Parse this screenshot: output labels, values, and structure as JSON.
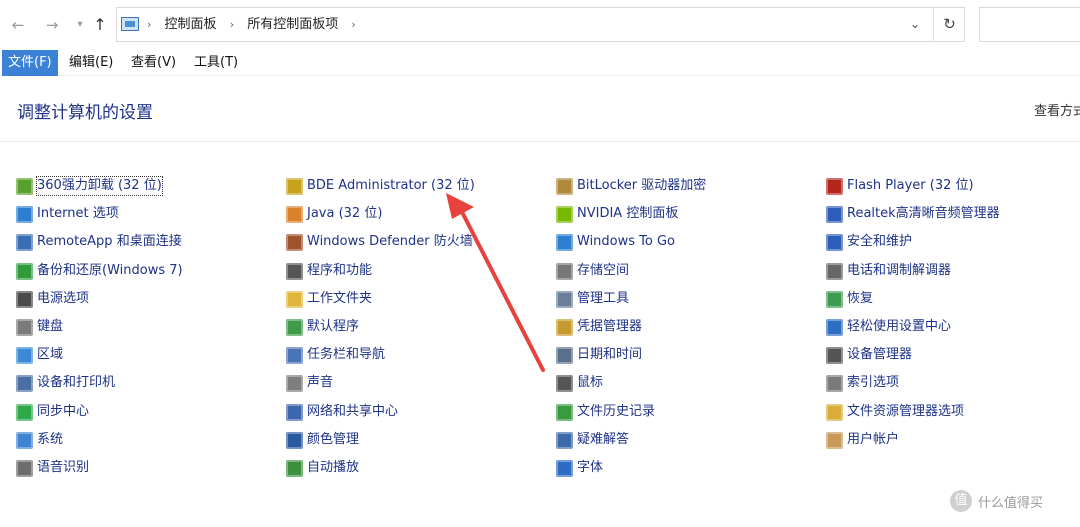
{
  "address": {
    "crumbs": [
      "控制面板",
      "所有控制面板项"
    ]
  },
  "menu": [
    "文件(F)",
    "编辑(E)",
    "查看(V)",
    "工具(T)"
  ],
  "header": {
    "title": "调整计算机的设置",
    "view_by": "查看方式"
  },
  "columns": [
    [
      {
        "label": "360强力卸载 (32 位)",
        "icon": "uninstall-icon",
        "color": "#5aa02c"
      },
      {
        "label": "Internet 选项",
        "icon": "internet-options-icon",
        "color": "#2f7fd1"
      },
      {
        "label": "RemoteApp 和桌面连接",
        "icon": "remoteapp-icon",
        "color": "#3a6fb5"
      },
      {
        "label": "备份和还原(Windows 7)",
        "icon": "backup-icon",
        "color": "#2f9b3c"
      },
      {
        "label": "电源选项",
        "icon": "power-icon",
        "color": "#4a4a4a"
      },
      {
        "label": "键盘",
        "icon": "keyboard-icon",
        "color": "#7a7a7a"
      },
      {
        "label": "区域",
        "icon": "region-globe-icon",
        "color": "#3b8ad6"
      },
      {
        "label": "设备和打印机",
        "icon": "printer-icon",
        "color": "#4b6fa3"
      },
      {
        "label": "同步中心",
        "icon": "sync-icon",
        "color": "#2fa84a"
      },
      {
        "label": "系统",
        "icon": "system-monitor-icon",
        "color": "#3f83d1"
      },
      {
        "label": "语音识别",
        "icon": "microphone-icon",
        "color": "#6d6d6d"
      }
    ],
    [
      {
        "label": "BDE Administrator (32 位)",
        "icon": "bde-admin-icon",
        "color": "#c7a21c"
      },
      {
        "label": "Java (32 位)",
        "icon": "java-icon",
        "color": "#d9822b"
      },
      {
        "label": "Windows Defender 防火墙",
        "icon": "firewall-icon",
        "color": "#a0522d"
      },
      {
        "label": "程序和功能",
        "icon": "programs-icon",
        "color": "#555555"
      },
      {
        "label": "工作文件夹",
        "icon": "work-folder-icon",
        "color": "#e0b53a"
      },
      {
        "label": "默认程序",
        "icon": "default-programs-icon",
        "color": "#3f9a4a"
      },
      {
        "label": "任务栏和导航",
        "icon": "taskbar-icon",
        "color": "#4a74b8"
      },
      {
        "label": "声音",
        "icon": "speaker-icon",
        "color": "#7d7d7d"
      },
      {
        "label": "网络和共享中心",
        "icon": "network-icon",
        "color": "#3c66ad"
      },
      {
        "label": "颜色管理",
        "icon": "color-management-icon",
        "color": "#2c5aa0"
      },
      {
        "label": "自动播放",
        "icon": "autoplay-icon",
        "color": "#3c8f3c"
      }
    ],
    [
      {
        "label": "BitLocker 驱动器加密",
        "icon": "bitlocker-icon",
        "color": "#b08a3c"
      },
      {
        "label": "NVIDIA 控制面板",
        "icon": "nvidia-icon",
        "color": "#76b900"
      },
      {
        "label": "Windows To Go",
        "icon": "windows-to-go-icon",
        "color": "#2d7fd1"
      },
      {
        "label": "存储空间",
        "icon": "storage-icon",
        "color": "#777777"
      },
      {
        "label": "管理工具",
        "icon": "admin-tools-icon",
        "color": "#6b7f96"
      },
      {
        "label": "凭据管理器",
        "icon": "credential-icon",
        "color": "#c69a2e"
      },
      {
        "label": "日期和时间",
        "icon": "clock-icon",
        "color": "#5a6f8a"
      },
      {
        "label": "鼠标",
        "icon": "mouse-icon",
        "color": "#555555"
      },
      {
        "label": "文件历史记录",
        "icon": "file-history-icon",
        "color": "#3a9a3e"
      },
      {
        "label": "疑难解答",
        "icon": "troubleshoot-icon",
        "color": "#3d6aa8"
      },
      {
        "label": "字体",
        "icon": "font-icon",
        "color": "#2c6cc4"
      }
    ],
    [
      {
        "label": "Flash Player (32 位)",
        "icon": "flash-icon",
        "color": "#b3261e"
      },
      {
        "label": "Realtek高清晰音频管理器",
        "icon": "realtek-audio-icon",
        "color": "#2d5db8"
      },
      {
        "label": "安全和维护",
        "icon": "flag-icon",
        "color": "#2d5db8"
      },
      {
        "label": "电话和调制解调器",
        "icon": "modem-icon",
        "color": "#666666"
      },
      {
        "label": "恢复",
        "icon": "recovery-icon",
        "color": "#3f9b52"
      },
      {
        "label": "轻松使用设置中心",
        "icon": "ease-of-access-icon",
        "color": "#2e6fc4"
      },
      {
        "label": "设备管理器",
        "icon": "device-manager-icon",
        "color": "#555555"
      },
      {
        "label": "索引选项",
        "icon": "indexing-icon",
        "color": "#7a7a7a"
      },
      {
        "label": "文件资源管理器选项",
        "icon": "explorer-options-icon",
        "color": "#d8ad3a"
      },
      {
        "label": "用户帐户",
        "icon": "user-accounts-icon",
        "color": "#c79a5a"
      }
    ]
  ],
  "watermark": {
    "logo": "值",
    "text": "什么值得买"
  }
}
